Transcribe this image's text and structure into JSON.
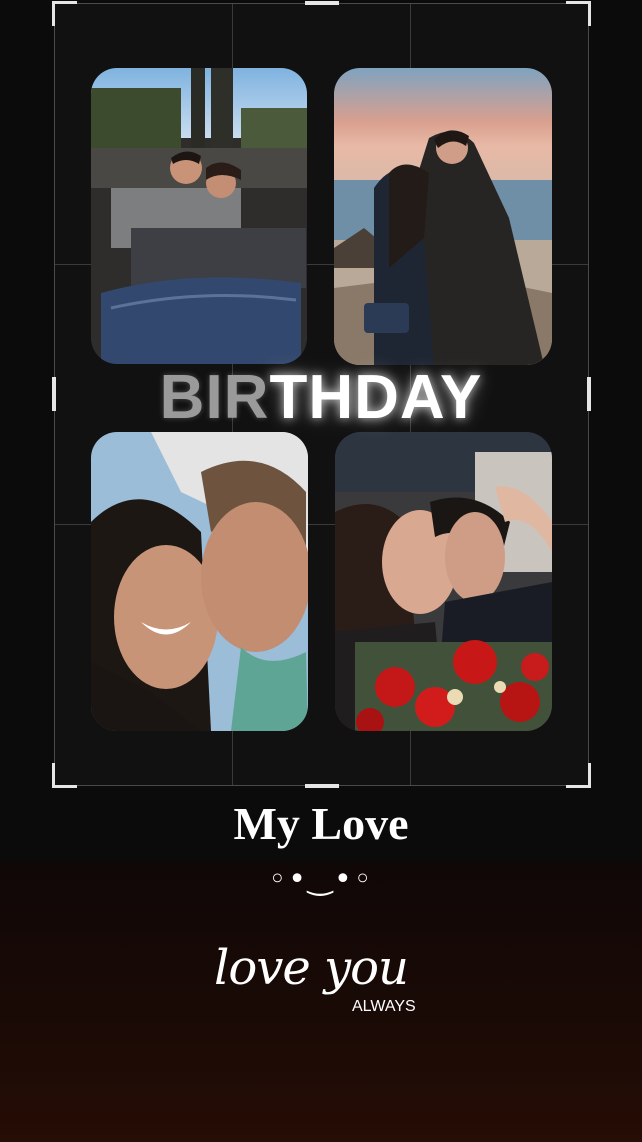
{
  "heading": {
    "part_dim": "BIR",
    "part_bright": "THDAY"
  },
  "title": "My Love",
  "kaomoji": "◦•‿•◦",
  "script_text": "love you",
  "script_sub": "ALWAYS",
  "photos": [
    {
      "id": "couple-on-sofa"
    },
    {
      "id": "couple-kiss-beach-sunset"
    },
    {
      "id": "couple-selfie-smiling"
    },
    {
      "id": "couple-kiss-roses"
    }
  ]
}
